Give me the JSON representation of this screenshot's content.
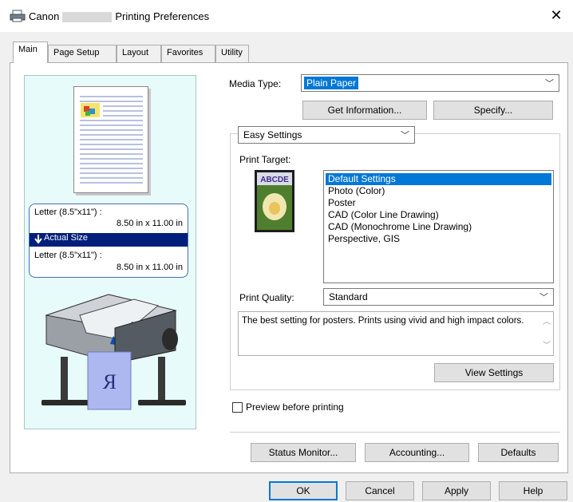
{
  "window": {
    "title_prefix": "Canon",
    "title_suffix": "Printing Preferences",
    "close_glyph": "✕"
  },
  "tabs": [
    {
      "label": "Main",
      "active": true
    },
    {
      "label": "Page Setup",
      "active": false
    },
    {
      "label": "Layout",
      "active": false
    },
    {
      "label": "Favorites",
      "active": false
    },
    {
      "label": "Utility",
      "active": false
    }
  ],
  "preview": {
    "paper_from_name": "Letter (8.5\"x11\") :",
    "paper_from_size": "8.50 in x 11.00 in",
    "scaling_label": "Actual Size",
    "paper_to_name": "Letter (8.5\"x11\") :",
    "paper_to_size": "8.50 in x 11.00 in",
    "output_letter": "R"
  },
  "media_type": {
    "label": "Media Type:",
    "value": "Plain Paper"
  },
  "buttons": {
    "get_information": "Get Information...",
    "specify": "Specify...",
    "view_settings": "View Settings",
    "status_monitor": "Status Monitor...",
    "accounting": "Accounting...",
    "defaults": "Defaults",
    "ok": "OK",
    "cancel": "Cancel",
    "apply": "Apply",
    "help": "Help"
  },
  "settings_mode": {
    "value": "Easy Settings"
  },
  "print_target": {
    "label": "Print Target:",
    "icon_text": "ABCDE",
    "items": [
      {
        "label": "Default Settings",
        "selected": true
      },
      {
        "label": "Photo (Color)",
        "selected": false
      },
      {
        "label": "Poster",
        "selected": false
      },
      {
        "label": "CAD (Color Line Drawing)",
        "selected": false
      },
      {
        "label": "CAD (Monochrome Line Drawing)",
        "selected": false
      },
      {
        "label": "Perspective, GIS",
        "selected": false
      }
    ]
  },
  "print_quality": {
    "label": "Print Quality:",
    "value": "Standard"
  },
  "description": "The best setting for posters. Prints using vivid and high impact colors.",
  "preview_before_printing": {
    "label": "Preview before printing",
    "checked": false
  },
  "colors": {
    "accent": "#0078d7",
    "band": "#001f7a",
    "preview_bg": "#e8fbfb"
  }
}
